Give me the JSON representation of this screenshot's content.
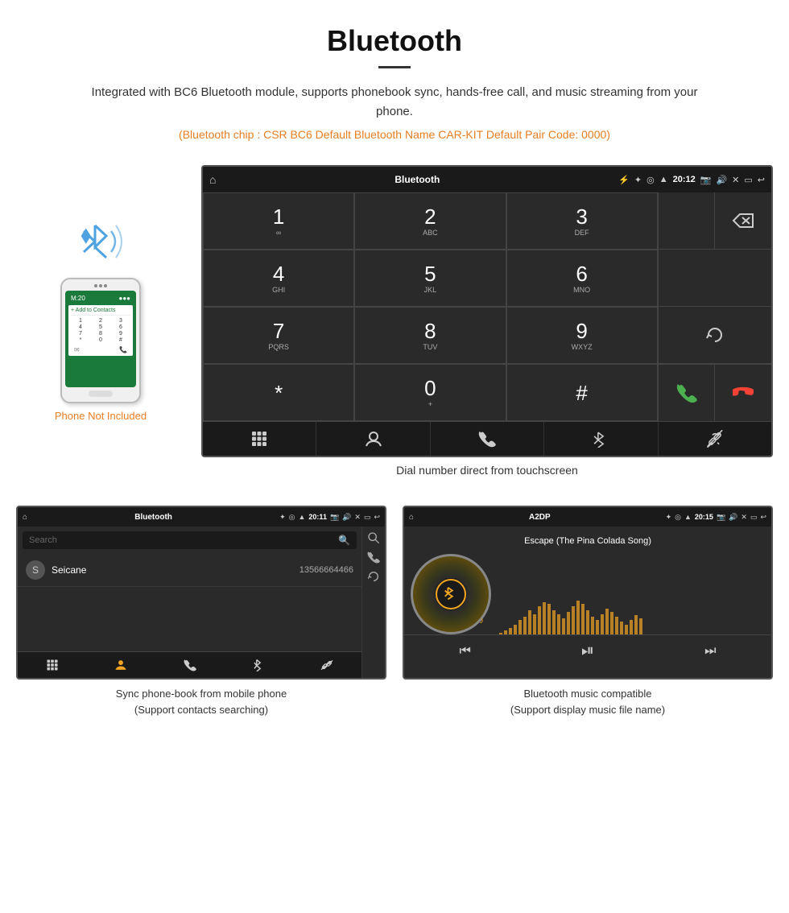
{
  "header": {
    "title": "Bluetooth",
    "description": "Integrated with BC6 Bluetooth module, supports phonebook sync, hands-free call, and music streaming from your phone.",
    "specs": "(Bluetooth chip : CSR BC6   Default Bluetooth Name CAR-KIT    Default Pair Code: 0000)"
  },
  "large_screen": {
    "status_bar": {
      "title": "Bluetooth",
      "time": "20:12"
    },
    "dialpad": {
      "keys": [
        {
          "num": "1",
          "letters": "∞"
        },
        {
          "num": "2",
          "letters": "ABC"
        },
        {
          "num": "3",
          "letters": "DEF"
        },
        {
          "num": "4",
          "letters": "GHI"
        },
        {
          "num": "5",
          "letters": "JKL"
        },
        {
          "num": "6",
          "letters": "MNO"
        },
        {
          "num": "7",
          "letters": "PQRS"
        },
        {
          "num": "8",
          "letters": "TUV"
        },
        {
          "num": "9",
          "letters": "WXYZ"
        },
        {
          "num": "*",
          "letters": ""
        },
        {
          "num": "0",
          "letters": "+"
        },
        {
          "num": "#",
          "letters": ""
        }
      ]
    },
    "caption": "Dial number direct from touchscreen"
  },
  "phone_not_included": "Phone Not Included",
  "bottom_left": {
    "status_bar": {
      "title": "Bluetooth",
      "time": "20:11"
    },
    "search_placeholder": "Search",
    "contact": {
      "initial": "S",
      "name": "Seicane",
      "number": "13566664466"
    },
    "caption_line1": "Sync phone-book from mobile phone",
    "caption_line2": "(Support contacts searching)"
  },
  "bottom_right": {
    "status_bar": {
      "title": "A2DP",
      "time": "20:15"
    },
    "song_title": "Escape (The Pina Colada Song)",
    "caption_line1": "Bluetooth music compatible",
    "caption_line2": "(Support display music file name)"
  },
  "visualizer_bars": [
    2,
    5,
    8,
    12,
    18,
    22,
    30,
    25,
    35,
    40,
    38,
    30,
    25,
    20,
    28,
    35,
    42,
    38,
    30,
    22,
    18,
    25,
    32,
    28,
    22,
    16,
    12,
    18,
    24,
    20
  ],
  "watermark": "Seicane"
}
